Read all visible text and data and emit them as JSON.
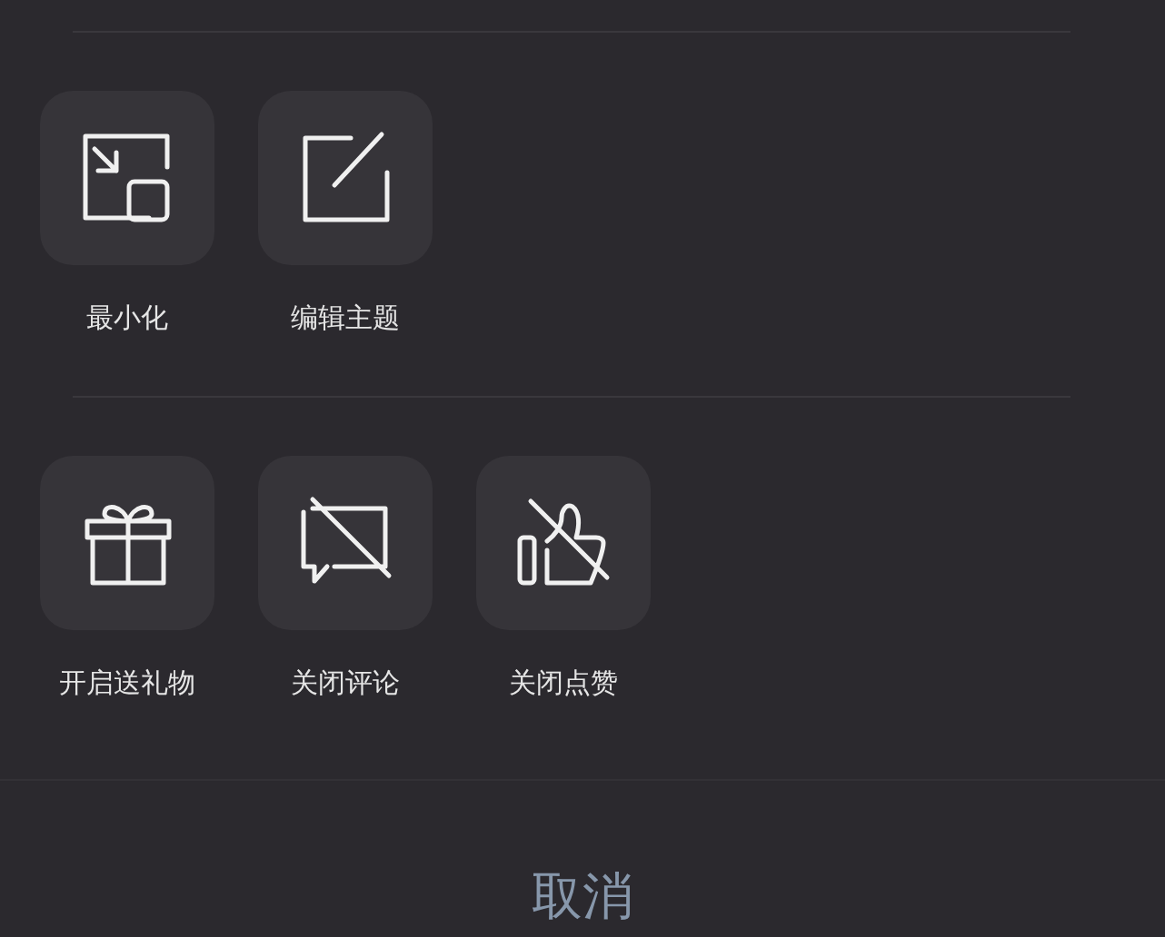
{
  "sections": [
    {
      "items": [
        {
          "label": "最小化",
          "kind": "minimize"
        },
        {
          "label": "编辑主题",
          "kind": "edit"
        }
      ]
    },
    {
      "items": [
        {
          "label": "开启送礼物",
          "kind": "gift"
        },
        {
          "label": "关闭评论",
          "kind": "comment-off"
        },
        {
          "label": "关闭点赞",
          "kind": "like-off"
        }
      ]
    }
  ],
  "cancel": "取消"
}
